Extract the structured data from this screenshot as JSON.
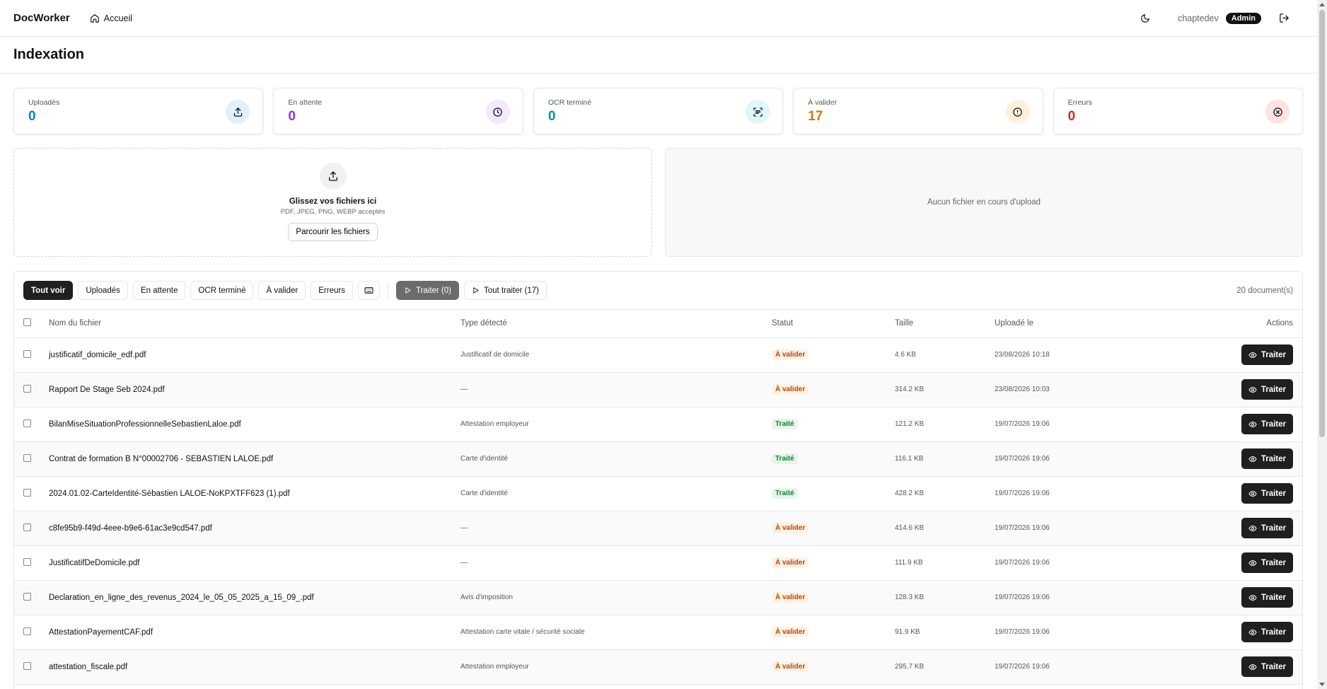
{
  "header": {
    "brand": "DocWorker",
    "home_label": "Accueil",
    "username": "chaptedev",
    "role": "Admin"
  },
  "page": {
    "title": "Indexation"
  },
  "stats": [
    {
      "label": "Uploadés",
      "value": "0",
      "color": "#0284c7",
      "icon_bg": "#e0f0fe",
      "icon": "upload-icon"
    },
    {
      "label": "En attente",
      "value": "0",
      "color": "#9333ea",
      "icon_bg": "#f3e8ff",
      "icon": "clock-icon"
    },
    {
      "label": "OCR terminé",
      "value": "0",
      "color": "#0891b2",
      "icon_bg": "#dff7fb",
      "icon": "scan-text-icon"
    },
    {
      "label": "À valider",
      "value": "17",
      "color": "#d97706",
      "icon_bg": "#fdf1dc",
      "icon": "alert-circle-icon"
    },
    {
      "label": "Erreurs",
      "value": "0",
      "color": "#dc2626",
      "icon_bg": "#fde3e3",
      "icon": "x-circle-icon"
    }
  ],
  "upload": {
    "title": "Glissez vos fichiers ici",
    "subtitle": "PDF, JPEG, PNG, WEBP acceptés",
    "browse_label": "Parcourir les fichiers",
    "empty_status": "Aucun fichier en cours d'upload"
  },
  "filters": {
    "all": "Tout voir",
    "uploaded": "Uploadés",
    "pending": "En attente",
    "ocr_done": "OCR terminé",
    "to_validate": "À valider",
    "errors": "Erreurs",
    "process_selected": "Traiter (0)",
    "process_all": "Tout traiter (17)",
    "count": "20 document(s)"
  },
  "table": {
    "headers": {
      "name": "Nom du fichier",
      "type": "Type détecté",
      "status": "Statut",
      "size": "Taille",
      "date": "Uploadé le",
      "actions": "Actions"
    },
    "action_label": "Traiter",
    "rows": [
      {
        "name": "justificatif_domicile_edf.pdf",
        "type": "Justificatif de domicile",
        "status": "À valider",
        "status_kind": "pending",
        "size": "4.6 KB",
        "date": "23/08/2026 10:18"
      },
      {
        "name": "Rapport De Stage Seb 2024.pdf",
        "type": "—",
        "status": "À valider",
        "status_kind": "pending",
        "size": "314.2 KB",
        "date": "23/08/2026 10:03"
      },
      {
        "name": "BilanMiseSituationProfessionnelleSebastienLaloe.pdf",
        "type": "Attestation employeur",
        "status": "Traité",
        "status_kind": "done",
        "size": "121.2 KB",
        "date": "19/07/2026 19:06"
      },
      {
        "name": "Contrat de formation B N°00002706 - SEBASTIEN LALOE.pdf",
        "type": "Carte d'identité",
        "status": "Traité",
        "status_kind": "done",
        "size": "116.1 KB",
        "date": "19/07/2026 19:06"
      },
      {
        "name": "2024.01.02-CarteIdentité-Sébastien LALOE-NoKPXTFF623 (1).pdf",
        "type": "Carte d'identité",
        "status": "Traité",
        "status_kind": "done",
        "size": "428.2 KB",
        "date": "19/07/2026 19:06"
      },
      {
        "name": "c8fe95b9-f49d-4eee-b9e6-61ac3e9cd547.pdf",
        "type": "—",
        "status": "À valider",
        "status_kind": "pending",
        "size": "414.6 KB",
        "date": "19/07/2026 19:06"
      },
      {
        "name": "JustificatifDeDomicile.pdf",
        "type": "—",
        "status": "À valider",
        "status_kind": "pending",
        "size": "111.9 KB",
        "date": "19/07/2026 19:06"
      },
      {
        "name": "Declaration_en_ligne_des_revenus_2024_le_05_05_2025_a_15_09_.pdf",
        "type": "Avis d'imposition",
        "status": "À valider",
        "status_kind": "pending",
        "size": "128.3 KB",
        "date": "19/07/2026 19:06"
      },
      {
        "name": "AttestationPayementCAF.pdf",
        "type": "Attestation carte vitale / sécurité sociale",
        "status": "À valider",
        "status_kind": "pending",
        "size": "91.9 KB",
        "date": "19/07/2026 19:06"
      },
      {
        "name": "attestation_fiscale.pdf",
        "type": "Attestation employeur",
        "status": "À valider",
        "status_kind": "pending",
        "size": "295.7 KB",
        "date": "19/07/2026 19:06"
      }
    ]
  }
}
